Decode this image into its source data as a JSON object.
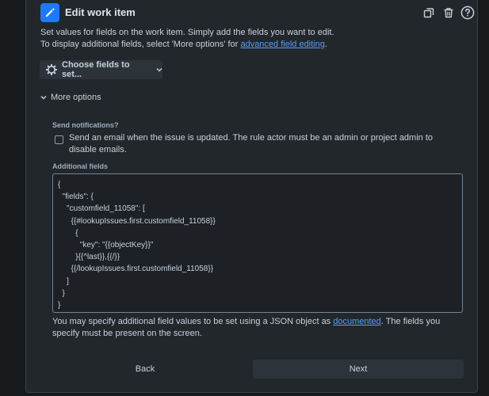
{
  "header": {
    "title": "Edit work item",
    "icons": [
      "pencil-icon",
      "copy-icon",
      "trash-icon",
      "help-icon"
    ]
  },
  "description": {
    "line1": "Set values for fields on the work item. Simply add the fields you want to edit.",
    "line2_prefix": "To display additional fields, select 'More options' for ",
    "line2_link": "advanced field editing",
    "line2_suffix": "."
  },
  "choose_fields_button": "Choose fields to set...",
  "more_options": "More options",
  "notifications": {
    "label": "Send notifications?",
    "checkbox_text": "Send an email when the issue is updated. The rule actor must be an admin or project admin to disable emails.",
    "checked": false
  },
  "additional_fields": {
    "label": "Additional fields",
    "value": "{\n  \"fields\": {\n    \"customfield_11058\": [\n      {{#lookupIssues.first.customfield_11058}}\n        {\n          \"key\": \"{{objectKey}}\"\n        }{{^last}},{{/}}\n      {{/lookupIssues.first.customfield_11058}}\n    ]\n  }\n}"
  },
  "help": {
    "prefix": "You may specify additional field values to be set using a JSON object as ",
    "link": "documented",
    "suffix": ". The fields you specify must be present on the screen."
  },
  "footer": {
    "back": "Back",
    "next": "Next"
  },
  "colors": {
    "background": "#161a1d",
    "panel": "#22272b",
    "accent": "#1d7afc",
    "link": "#579dff"
  }
}
